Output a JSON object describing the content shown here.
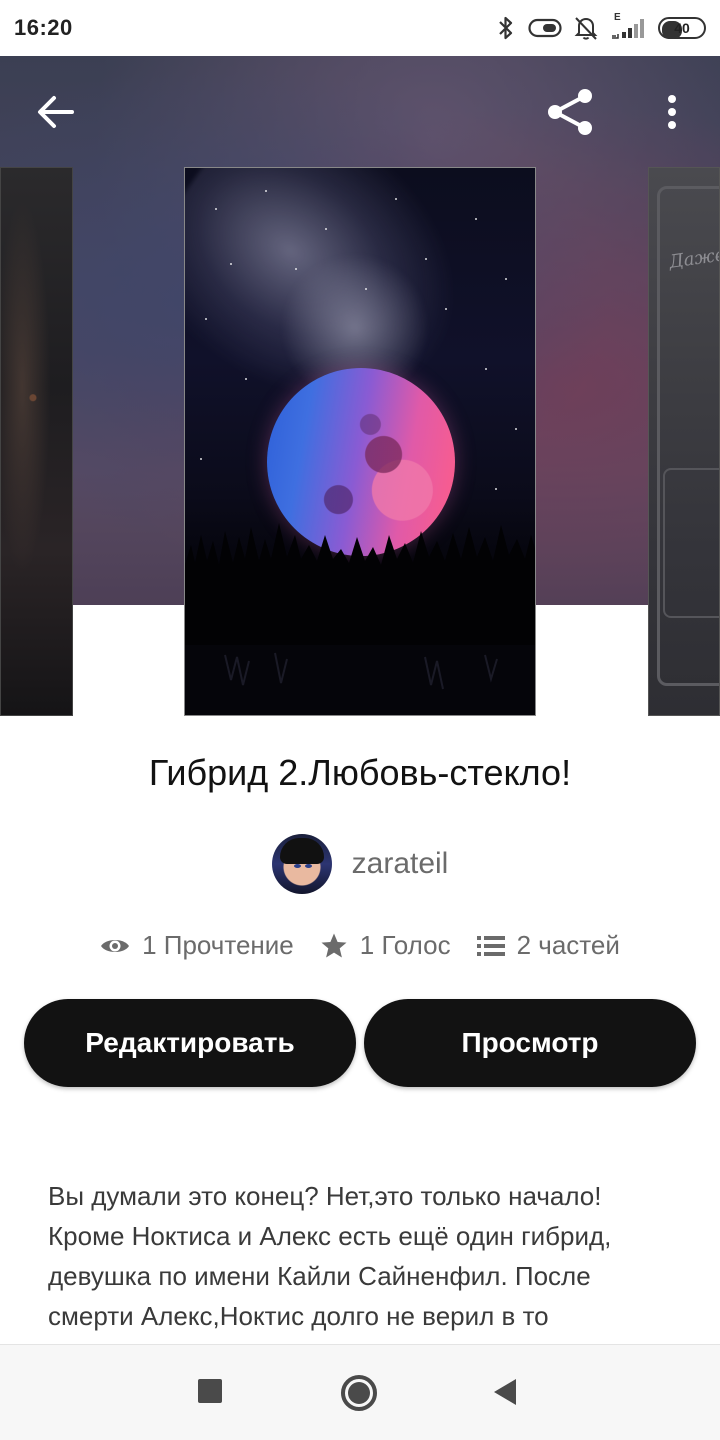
{
  "status_bar": {
    "time": "16:20",
    "network_label": "E",
    "battery_level": "40",
    "icons": [
      "bluetooth-icon",
      "toggle-icon",
      "bell-off-icon",
      "signal-icon",
      "battery-icon"
    ]
  },
  "topbar": {
    "icons": [
      "back-arrow-icon",
      "share-icon",
      "more-vertical-icon"
    ]
  },
  "covers": {
    "right_partial_text": "Даже"
  },
  "book": {
    "title": "Гибрид 2.Любовь-стекло!",
    "author": "zarateil",
    "stats": {
      "reads": "1 Прочтение",
      "votes": "1 Голос",
      "parts": "2 частей"
    },
    "description": "Вы думали это конец? Нет,это только начало! Кроме Ноктиса и Алекс есть ещё один гибрид, девушка по имени Кайли Сайненфил. После смерти Алекс,Ноктис долго не верил в то"
  },
  "actions": {
    "edit_label": "Редактировать",
    "view_label": "Просмотр"
  },
  "nav": {
    "icons": [
      "recents-icon",
      "home-icon",
      "back-icon"
    ]
  },
  "colors": {
    "button_bg": "#121212",
    "text_primary": "#121212",
    "text_secondary": "#6b6b6b"
  }
}
